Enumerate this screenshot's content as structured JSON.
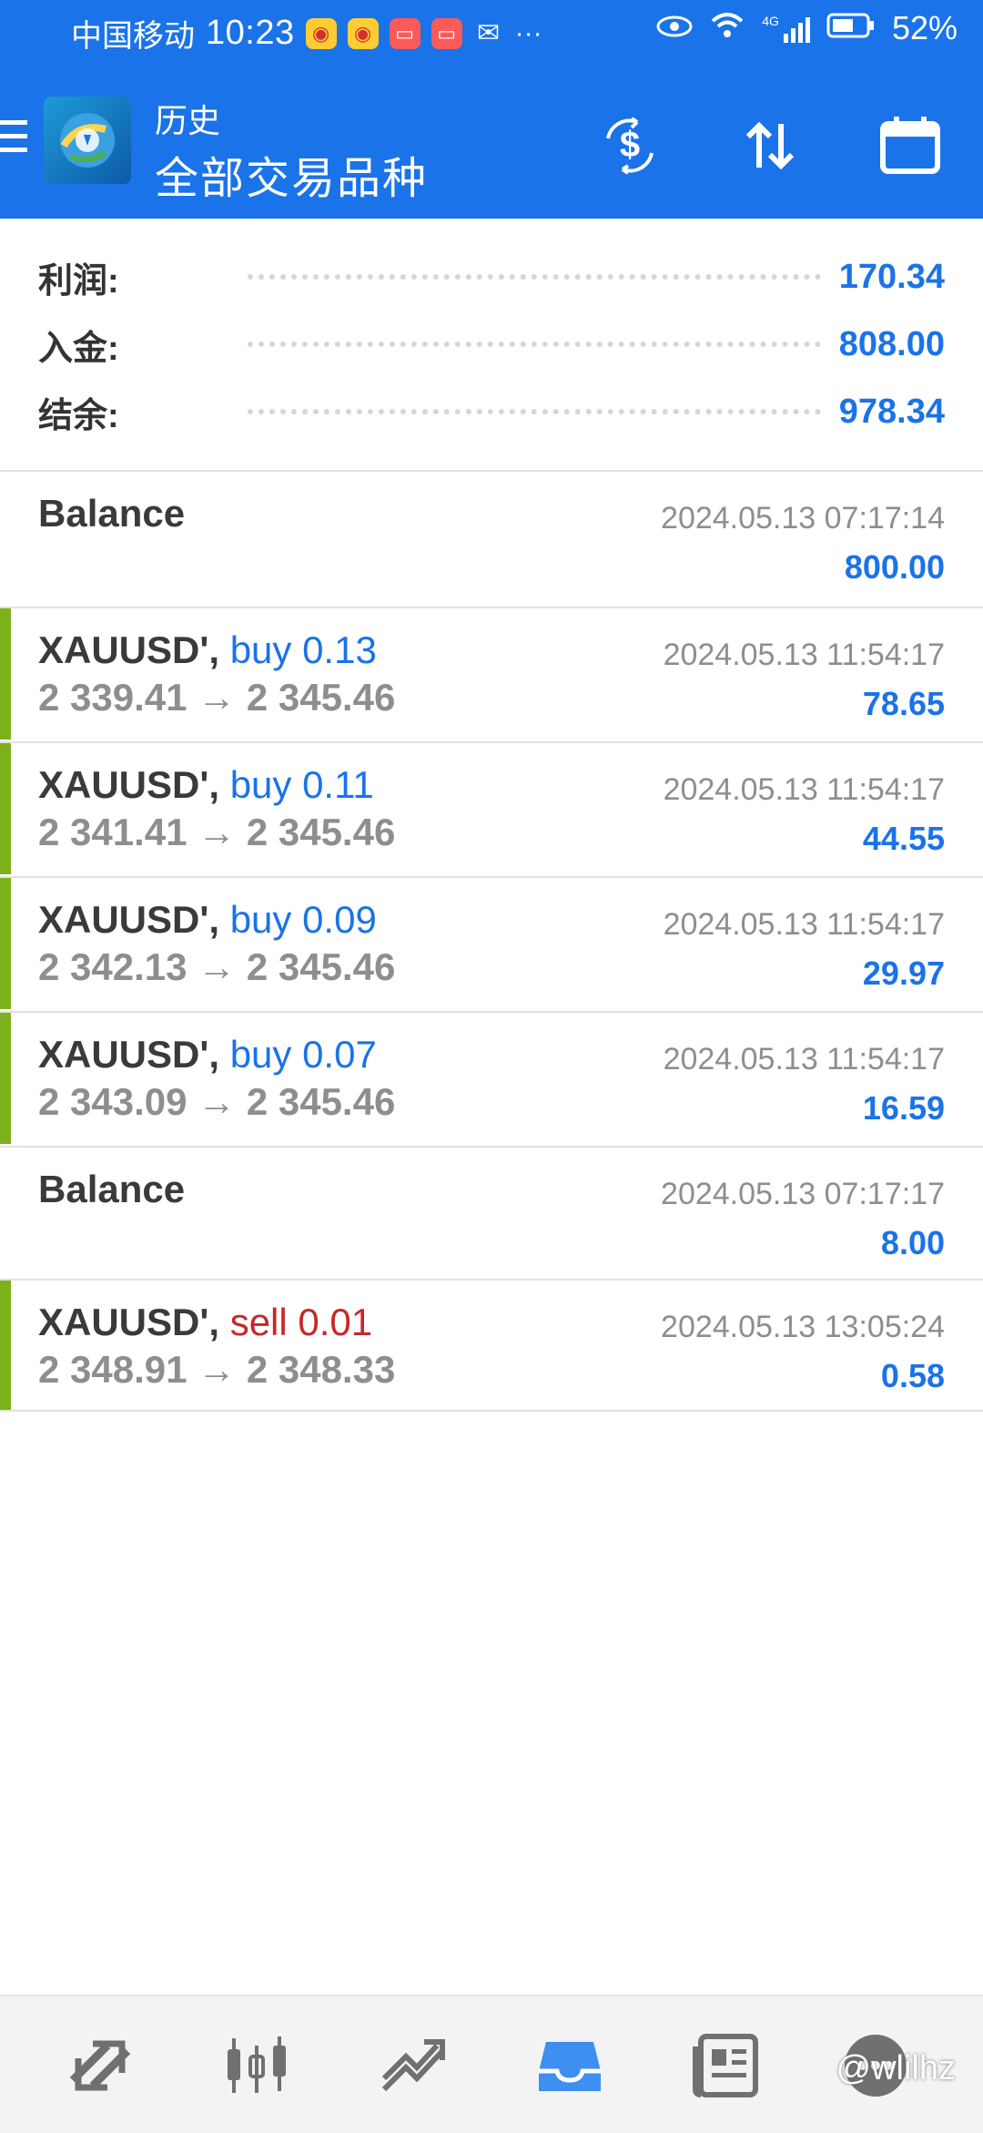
{
  "status_bar": {
    "carrier": "中国移动",
    "time": "10:23",
    "battery": "52%",
    "overflow": "···",
    "network": "4G"
  },
  "header": {
    "title": "历史",
    "subtitle": "全部交易品种"
  },
  "summary": {
    "profit_label": "利润:",
    "profit_value": "170.34",
    "deposit_label": "入金:",
    "deposit_value": "808.00",
    "balance_label": "结余:",
    "balance_value": "978.34"
  },
  "records": [
    {
      "type": "balance",
      "title": "Balance",
      "date": "2024.05.13 07:17:14",
      "amount": "800.00"
    },
    {
      "type": "trade",
      "symbol": "XAUUSD',",
      "side": "buy 0.13",
      "prices": "2 339.41 → 2 345.46",
      "date": "2024.05.13 11:54:17",
      "amount": "78.65"
    },
    {
      "type": "trade",
      "symbol": "XAUUSD',",
      "side": "buy 0.11",
      "prices": "2 341.41 → 2 345.46",
      "date": "2024.05.13 11:54:17",
      "amount": "44.55"
    },
    {
      "type": "trade",
      "symbol": "XAUUSD',",
      "side": "buy 0.09",
      "prices": "2 342.13 → 2 345.46",
      "date": "2024.05.13 11:54:17",
      "amount": "29.97"
    },
    {
      "type": "trade",
      "symbol": "XAUUSD',",
      "side": "buy 0.07",
      "prices": "2 343.09 → 2 345.46",
      "date": "2024.05.13 11:54:17",
      "amount": "16.59"
    },
    {
      "type": "balance",
      "title": "Balance",
      "date": "2024.05.13 07:17:17",
      "amount": "8.00"
    },
    {
      "type": "trade",
      "symbol": "XAUUSD',",
      "side": "sell 0.01",
      "prices": "2 348.91 → 2 348.33",
      "date": "2024.05.13 13:05:24",
      "amount": "0.58"
    }
  ],
  "bottom_nav": [
    "quotes-icon",
    "chart-icon",
    "trade-icon",
    "history-icon",
    "news-icon",
    "chat-icon"
  ],
  "watermark": "@wlilhz",
  "colors": {
    "primary": "#1a73e8",
    "buy": "#1a73e8",
    "sell": "#c62828",
    "accent_bar": "#7cb11a",
    "muted": "#8e8e8e"
  }
}
